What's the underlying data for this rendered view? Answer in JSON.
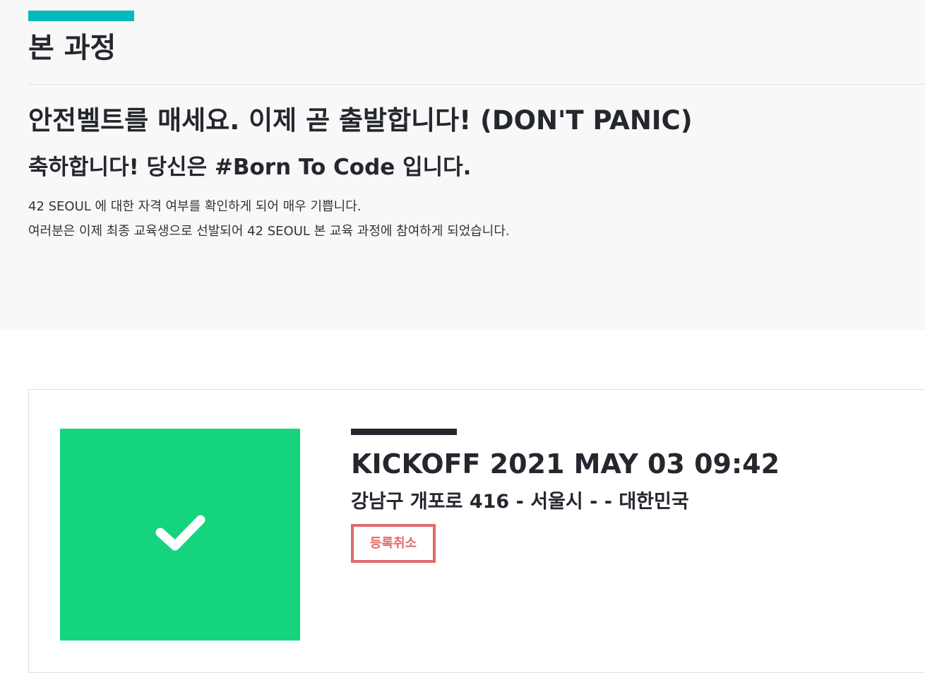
{
  "colors": {
    "accent": "#00babc",
    "success": "#15d47e",
    "danger": "#e06a6a",
    "dark": "#25272e"
  },
  "header": {
    "section_title": "본 과정"
  },
  "welcome": {
    "headline": "안전벨트를 매세요. 이제 곧 출발합니다! (DON'T PANIC)",
    "subheadline": "축하합니다! 당신은 #Born To Code 입니다.",
    "message_line1": "42 SEOUL 에 대한 자격 여부를 확인하게 되어 매우 기쁩니다.",
    "message_line2": "여러분은 이제 최종 교육생으로 선발되어 42 SEOUL 본 교육 과정에 참여하게 되었습니다."
  },
  "event": {
    "status_icon": "check-icon",
    "title": "KICKOFF 2021 MAY 03 09:42",
    "location": "강남구 개포로 416 - 서울시 - - 대한민국",
    "cancel_label": "등록취소"
  }
}
